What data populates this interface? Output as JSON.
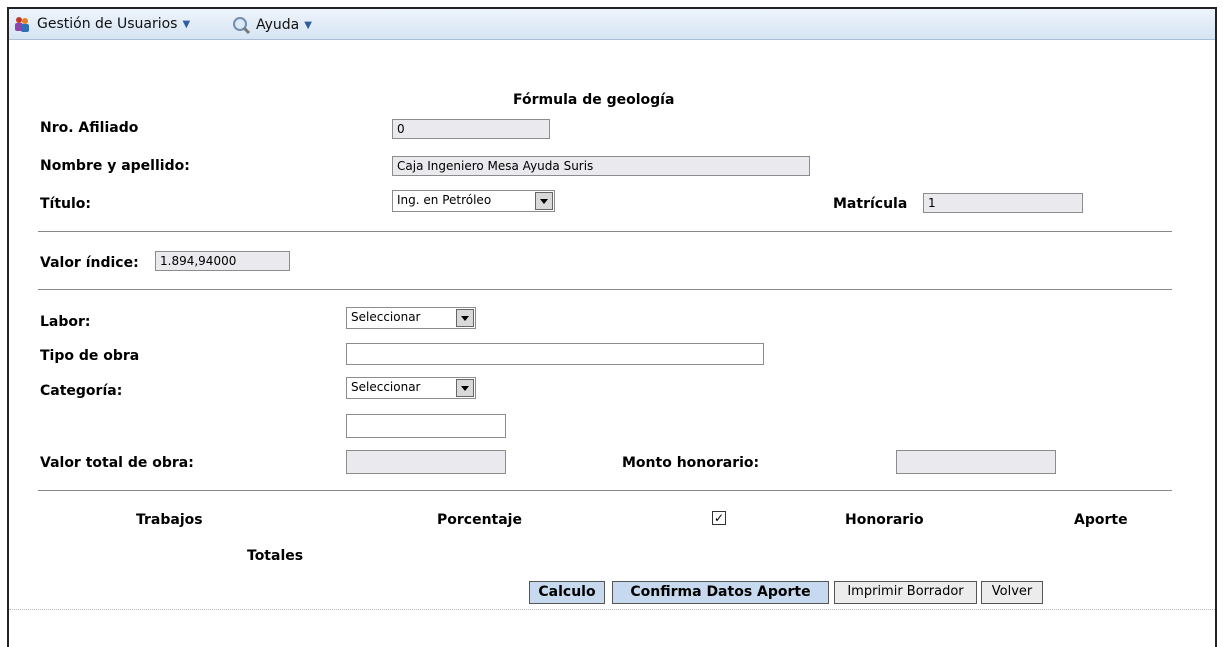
{
  "menu": {
    "users_label": "Gestión de Usuarios",
    "help_label": "Ayuda"
  },
  "form": {
    "title": "Fórmula de geología",
    "afiliado_label": "Nro. Afiliado",
    "afiliado_value": "0",
    "nombre_label": "Nombre y apellido:",
    "nombre_value": "Caja Ingeniero Mesa Ayuda Suris",
    "titulo_label": "Título:",
    "titulo_value": "Ing. en Petróleo",
    "matricula_label": "Matrícula",
    "matricula_value": "1",
    "valor_indice_label": "Valor índice:",
    "valor_indice_value": "1.894,94000",
    "labor_label": "Labor:",
    "labor_value": "Seleccionar",
    "tipo_obra_label": "Tipo de obra",
    "tipo_obra_value": "",
    "categoria_label": "Categoría:",
    "categoria_value": "Seleccionar",
    "extra_value": "",
    "valor_total_label": "Valor total de obra:",
    "valor_total_value": "",
    "monto_label": "Monto honorario:",
    "monto_value": ""
  },
  "table": {
    "trabajos": "Trabajos",
    "porcentaje": "Porcentaje",
    "checkbox_checked": true,
    "honorario": "Honorario",
    "aporte": "Aporte",
    "totales": "Totales"
  },
  "buttons": {
    "calculo": "Calculo",
    "confirma": "Confirma Datos Aporte",
    "imprimir": "Imprimir Borrador",
    "volver": "Volver"
  }
}
